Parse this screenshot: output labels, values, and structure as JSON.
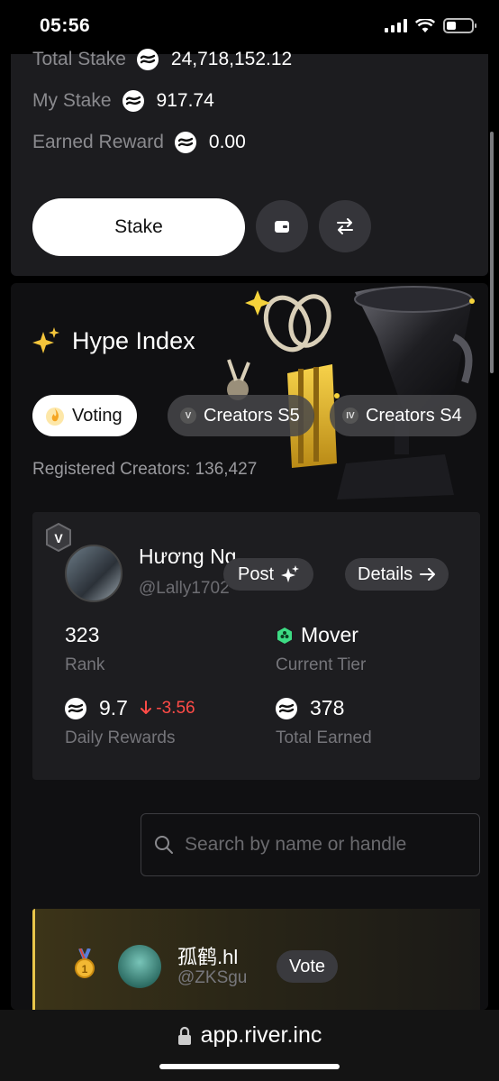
{
  "status_bar": {
    "time": "05:56"
  },
  "stake": {
    "total_stake_label": "Total Stake",
    "total_stake_value": "24,718,152.12",
    "my_stake_label": "My Stake",
    "my_stake_value": "917.74",
    "earned_reward_label": "Earned Reward",
    "earned_reward_value": "0.00",
    "stake_button": "Stake",
    "wallet_icon": "wallet-icon",
    "swap_icon": "swap-arrows-icon"
  },
  "hype": {
    "title": "Hype Index",
    "tabs": [
      {
        "label": "Voting",
        "icon": "flame-icon",
        "active": true
      },
      {
        "label": "Creators S5",
        "badge": "V",
        "active": false
      },
      {
        "label": "Creators S4",
        "badge": "IV",
        "active": false
      }
    ],
    "registered_label": "Registered Creators: 136,427"
  },
  "creator_card": {
    "season_badge": "V",
    "name": "Hương Ng",
    "handle": "@Lally1702",
    "post_button": "Post",
    "details_button": "Details",
    "rank_value": "323",
    "rank_label": "Rank",
    "tier_value": "Mover",
    "tier_label": "Current Tier",
    "daily_rewards_value": "9.7",
    "daily_rewards_delta": "-3.56",
    "daily_rewards_label": "Daily Rewards",
    "total_earned_value": "378",
    "total_earned_label": "Total Earned",
    "tier_color": "#3ddc84",
    "delta_color": "#ff4b47"
  },
  "search": {
    "placeholder": "Search by name or handle"
  },
  "leaderboard": [
    {
      "rank_icon": "gold-medal-icon",
      "name": "孤鹤.hl",
      "handle": "@ZKSgu",
      "vote_button": "Vote"
    }
  ],
  "browser": {
    "url": "app.river.inc"
  },
  "colors": {
    "accent_gold": "#e9c64a",
    "card_bg": "#1c1c1f"
  }
}
